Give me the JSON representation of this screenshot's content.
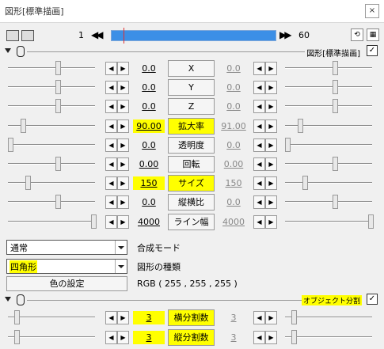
{
  "window": {
    "title": "図形[標準描画]",
    "close_label": "×"
  },
  "frame": {
    "start": "1",
    "end": "60"
  },
  "section1": {
    "label": "図形[標準描画]",
    "checked": "✓"
  },
  "params": [
    {
      "name": "X",
      "left": "0.0",
      "right": "0.0",
      "highlight": false
    },
    {
      "name": "Y",
      "left": "0.0",
      "right": "0.0",
      "highlight": false
    },
    {
      "name": "Z",
      "left": "0.0",
      "right": "0.0",
      "highlight": false
    },
    {
      "name": "拡大率",
      "left": "90.00",
      "right": "91.00",
      "highlight": true
    },
    {
      "name": "透明度",
      "left": "0.0",
      "right": "0.0",
      "highlight": false
    },
    {
      "name": "回転",
      "left": "0.00",
      "right": "0.00",
      "highlight": false
    },
    {
      "name": "サイズ",
      "left": "150",
      "right": "150",
      "highlight": true
    },
    {
      "name": "縦横比",
      "left": "0.0",
      "right": "0.0",
      "highlight": false
    },
    {
      "name": "ライン幅",
      "left": "4000",
      "right": "4000",
      "highlight": false
    }
  ],
  "blend": {
    "value": "通常",
    "label": "合成モード"
  },
  "shape": {
    "value": "四角形",
    "label": "図形の種類"
  },
  "color": {
    "button": "色の設定",
    "rgb": "RGB ( 255 , 255 , 255 )"
  },
  "section2": {
    "label": "オブジェクト分割",
    "checked": "✓"
  },
  "split": [
    {
      "name": "横分割数",
      "left": "3",
      "right": "3"
    },
    {
      "name": "縦分割数",
      "left": "3",
      "right": "3"
    }
  ],
  "colors": {
    "highlight": "#ffff00",
    "timeline": "#3c8fe6",
    "marker": "#e03030"
  },
  "icons": [
    "camera-icon",
    "settings-icon",
    "prev-frame-icon",
    "next-frame-icon",
    "collapse-icon",
    "mouse-icon",
    "left-arrow-icon",
    "right-arrow-icon",
    "dropdown-icon"
  ]
}
